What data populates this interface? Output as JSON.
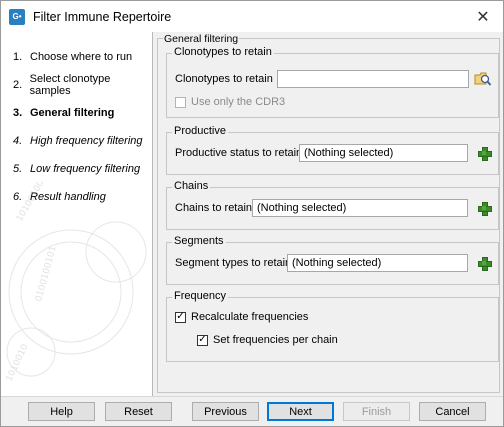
{
  "window": {
    "title": "Filter Immune Repertoire",
    "close_glyph": "✕",
    "app_icon_text": "G•"
  },
  "steps": [
    {
      "num": "1.",
      "label": "Choose where to run",
      "state": "done"
    },
    {
      "num": "2.",
      "label": "Select clonotype samples",
      "state": "done"
    },
    {
      "num": "3.",
      "label": "General filtering",
      "state": "active"
    },
    {
      "num": "4.",
      "label": "High frequency filtering",
      "state": "future"
    },
    {
      "num": "5.",
      "label": "Low frequency filtering",
      "state": "future"
    },
    {
      "num": "6.",
      "label": "Result handling",
      "state": "future"
    }
  ],
  "general_filtering": {
    "title": "General filtering",
    "clonotypes": {
      "legend": "Clonotypes to retain",
      "label": "Clonotypes to retain",
      "value": "",
      "browse_icon": "folder-search-icon",
      "cdr3_label": "Use only the CDR3",
      "cdr3_checked": false
    },
    "productive": {
      "legend": "Productive",
      "label": "Productive status to retain",
      "value": "(Nothing selected)"
    },
    "chains": {
      "legend": "Chains",
      "label": "Chains to retain",
      "value": "(Nothing selected)"
    },
    "segments": {
      "legend": "Segments",
      "label": "Segment types to retain",
      "value": "(Nothing selected)"
    },
    "frequency": {
      "legend": "Frequency",
      "recalc_label": "Recalculate frequencies",
      "recalc_checked": true,
      "per_chain_label": "Set frequencies per chain",
      "per_chain_checked": true
    }
  },
  "buttons": {
    "help": "Help",
    "reset": "Reset",
    "previous": "Previous",
    "next": "Next",
    "finish": "Finish",
    "cancel": "Cancel"
  },
  "colors": {
    "add_icon": "#3d8a2a",
    "focus_border": "#0078d7"
  }
}
